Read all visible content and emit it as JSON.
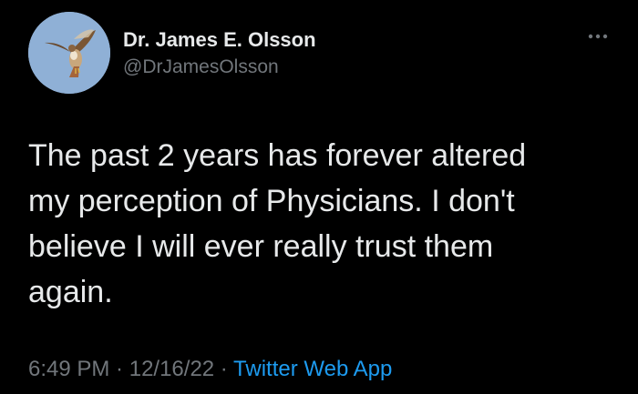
{
  "author": {
    "display_name": "Dr. James E. Olsson",
    "handle": "@DrJamesOlsson",
    "avatar_icon": "hawk-avatar-icon"
  },
  "menu": {
    "icon": "more-options-icon"
  },
  "tweet": {
    "text": "The past 2 years has forever altered\nmy perception of Physicians. I don't\nbelieve I will ever really trust them\nagain.",
    "time": "6:49 PM",
    "separator": " · ",
    "date": "12/16/22",
    "source": "Twitter Web App"
  },
  "colors": {
    "background": "#000000",
    "primary_text": "#e7e9ea",
    "secondary_text": "#71767b",
    "link": "#1d9bf0"
  }
}
